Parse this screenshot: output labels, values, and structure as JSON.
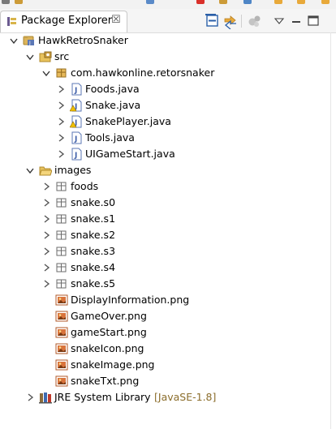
{
  "view": {
    "title": "Package Explorer",
    "close_glyph": "☒",
    "toolbar": [
      {
        "name": "collapse-all-icon"
      },
      {
        "name": "link-with-editor-icon"
      },
      {
        "name": "filters-icon"
      },
      {
        "name": "view-menu-icon"
      },
      {
        "name": "minimize-icon"
      },
      {
        "name": "maximize-icon"
      }
    ]
  },
  "tree": [
    {
      "label": "HawkRetroSnaker",
      "icon": "java-project-icon",
      "arrow": "down",
      "depth": 0
    },
    {
      "label": "src",
      "icon": "source-folder-icon",
      "arrow": "down",
      "depth": 1
    },
    {
      "label": "com.hawkonline.retorsnaker",
      "icon": "package-icon",
      "arrow": "down",
      "depth": 2
    },
    {
      "label": "Foods.java",
      "icon": "java-file-icon",
      "arrow": "right",
      "depth": 3
    },
    {
      "label": "Snake.java",
      "icon": "java-file-warning-icon",
      "arrow": "right",
      "depth": 3
    },
    {
      "label": "SnakePlayer.java",
      "icon": "java-file-warning-icon",
      "arrow": "right",
      "depth": 3
    },
    {
      "label": "Tools.java",
      "icon": "java-file-icon",
      "arrow": "right",
      "depth": 3
    },
    {
      "label": "UIGameStart.java",
      "icon": "java-file-icon",
      "arrow": "right",
      "depth": 3
    },
    {
      "label": "images",
      "icon": "folder-open-icon",
      "arrow": "down",
      "depth": 1
    },
    {
      "label": "foods",
      "icon": "package-outline-icon",
      "arrow": "right",
      "depth": 2
    },
    {
      "label": "snake.s0",
      "icon": "package-outline-icon",
      "arrow": "right",
      "depth": 2
    },
    {
      "label": "snake.s1",
      "icon": "package-outline-icon",
      "arrow": "right",
      "depth": 2
    },
    {
      "label": "snake.s2",
      "icon": "package-outline-icon",
      "arrow": "right",
      "depth": 2
    },
    {
      "label": "snake.s3",
      "icon": "package-outline-icon",
      "arrow": "right",
      "depth": 2
    },
    {
      "label": "snake.s4",
      "icon": "package-outline-icon",
      "arrow": "right",
      "depth": 2
    },
    {
      "label": "snake.s5",
      "icon": "package-outline-icon",
      "arrow": "right",
      "depth": 2
    },
    {
      "label": "DisplayInformation.png",
      "icon": "image-file-icon",
      "arrow": "none",
      "depth": 2
    },
    {
      "label": "GameOver.png",
      "icon": "image-file-icon",
      "arrow": "none",
      "depth": 2
    },
    {
      "label": "gameStart.png",
      "icon": "image-file-icon",
      "arrow": "none",
      "depth": 2
    },
    {
      "label": "snakeIcon.png",
      "icon": "image-file-icon",
      "arrow": "none",
      "depth": 2
    },
    {
      "label": "snakeImage.png",
      "icon": "image-file-icon",
      "arrow": "none",
      "depth": 2
    },
    {
      "label": "snakeTxt.png",
      "icon": "image-file-icon",
      "arrow": "none",
      "depth": 2
    },
    {
      "label": "JRE System Library",
      "decoration": "[JavaSE-1.8]",
      "icon": "library-icon",
      "arrow": "right",
      "depth": 1
    }
  ]
}
